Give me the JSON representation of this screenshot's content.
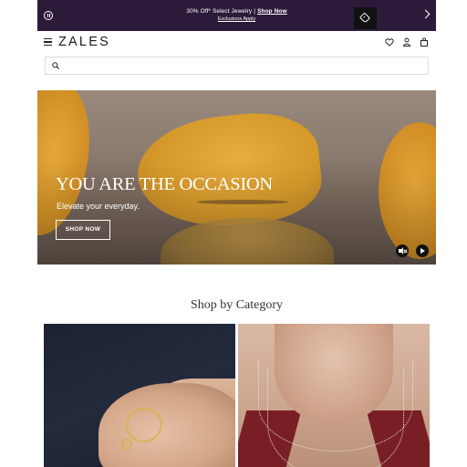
{
  "promo": {
    "offer_text": "30% Off* Select Jewelry",
    "separator": "|",
    "shop_link": "Shop Now",
    "exclusions": "Exclusions Apply",
    "background": "#2c1a3a"
  },
  "header": {
    "logo": "ZALES",
    "icons": [
      "menu-icon",
      "tag-icon",
      "heart-icon",
      "user-icon",
      "bag-icon"
    ]
  },
  "search": {
    "value": "",
    "placeholder": ""
  },
  "hero": {
    "headline": "YOU ARE THE OCCASION",
    "subtext": "Elevate your everyday.",
    "cta_label": "SHOP NOW",
    "controls": [
      "mute-icon",
      "play-icon"
    ]
  },
  "category": {
    "title": "Shop by Category"
  },
  "colors": {
    "promo_bg": "#2c1a3a",
    "accent_black": "#111111"
  }
}
